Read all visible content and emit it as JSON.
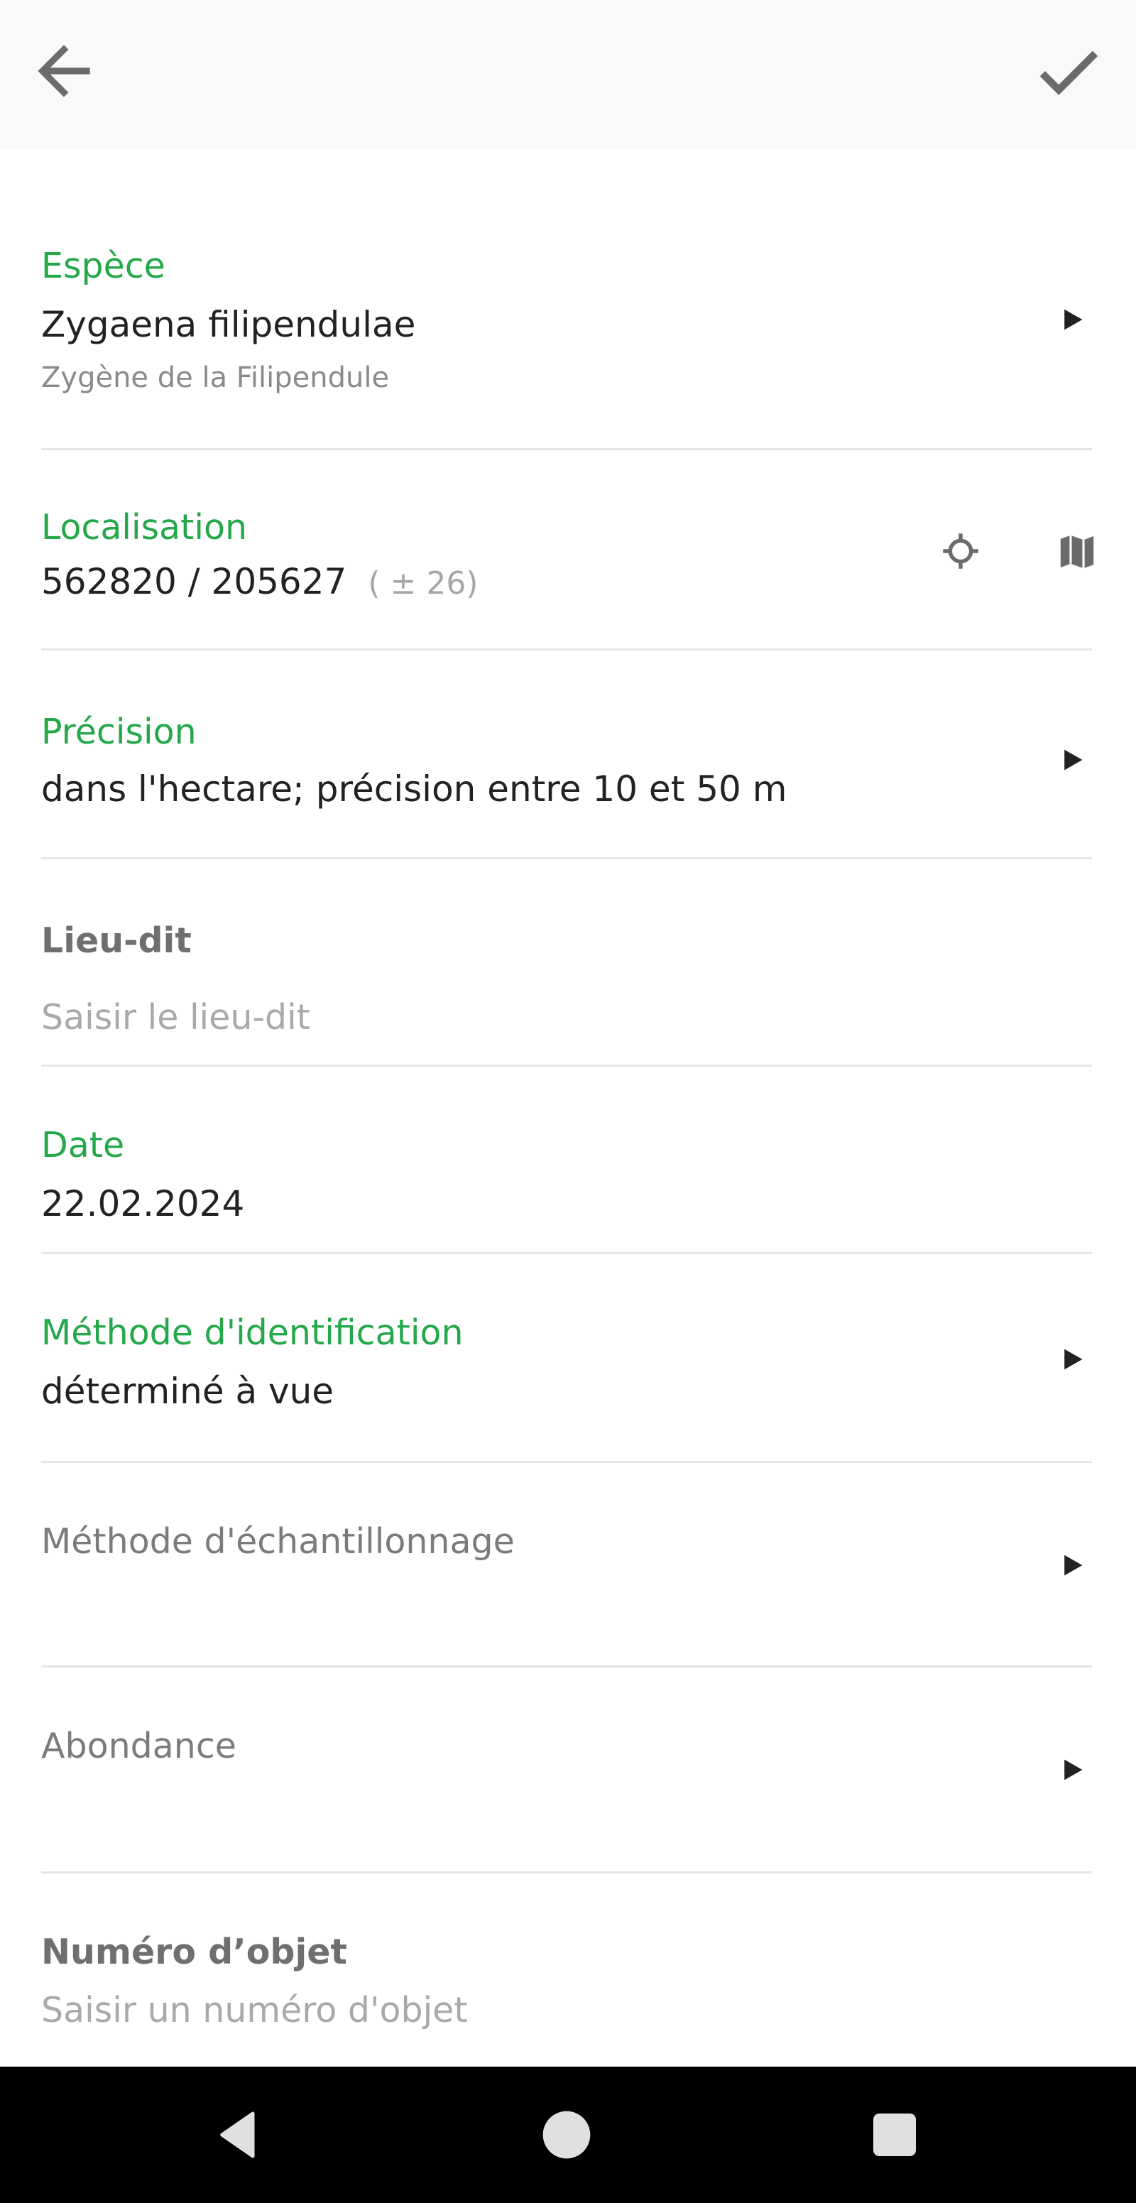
{
  "colors": {
    "accent_green": "#25a84a",
    "header_bg": "#f8f9fb",
    "icon_gray": "#6b6b6b",
    "navbar_bg": "#000000"
  },
  "header": {
    "back_icon": "back-arrow-icon",
    "confirm_icon": "check-icon"
  },
  "fields": {
    "espece": {
      "label": "Espèce",
      "value": "Zygaena filipendulae",
      "subvalue": "Zygène de la Filipendule",
      "icon": "chevron-right-icon"
    },
    "localisation": {
      "label": "Localisation",
      "value": "562820 / 205627",
      "accuracy": "( ± 26)",
      "icons": [
        "gps-crosshair-icon",
        "map-icon"
      ]
    },
    "precision": {
      "label": "Précision",
      "value": "dans l'hectare; précision entre 10 et 50 m",
      "icon": "chevron-right-icon"
    },
    "lieu_dit": {
      "label": "Lieu-dit",
      "placeholder": "Saisir le lieu-dit"
    },
    "date": {
      "label": "Date",
      "value": "22.02.2024"
    },
    "methode_identification": {
      "label": "Méthode d'identification",
      "value": "déterminé à vue",
      "icon": "chevron-right-icon"
    },
    "methode_echantillonnage": {
      "label": "Méthode d'échantillonnage",
      "icon": "chevron-right-icon"
    },
    "abondance": {
      "label": "Abondance",
      "icon": "chevron-right-icon"
    },
    "numero_objet": {
      "label": "Numéro d’objet",
      "placeholder": "Saisir un numéro d'objet"
    }
  },
  "navbar": {
    "icons": [
      "nav-back-icon",
      "nav-home-icon",
      "nav-recents-icon"
    ]
  }
}
